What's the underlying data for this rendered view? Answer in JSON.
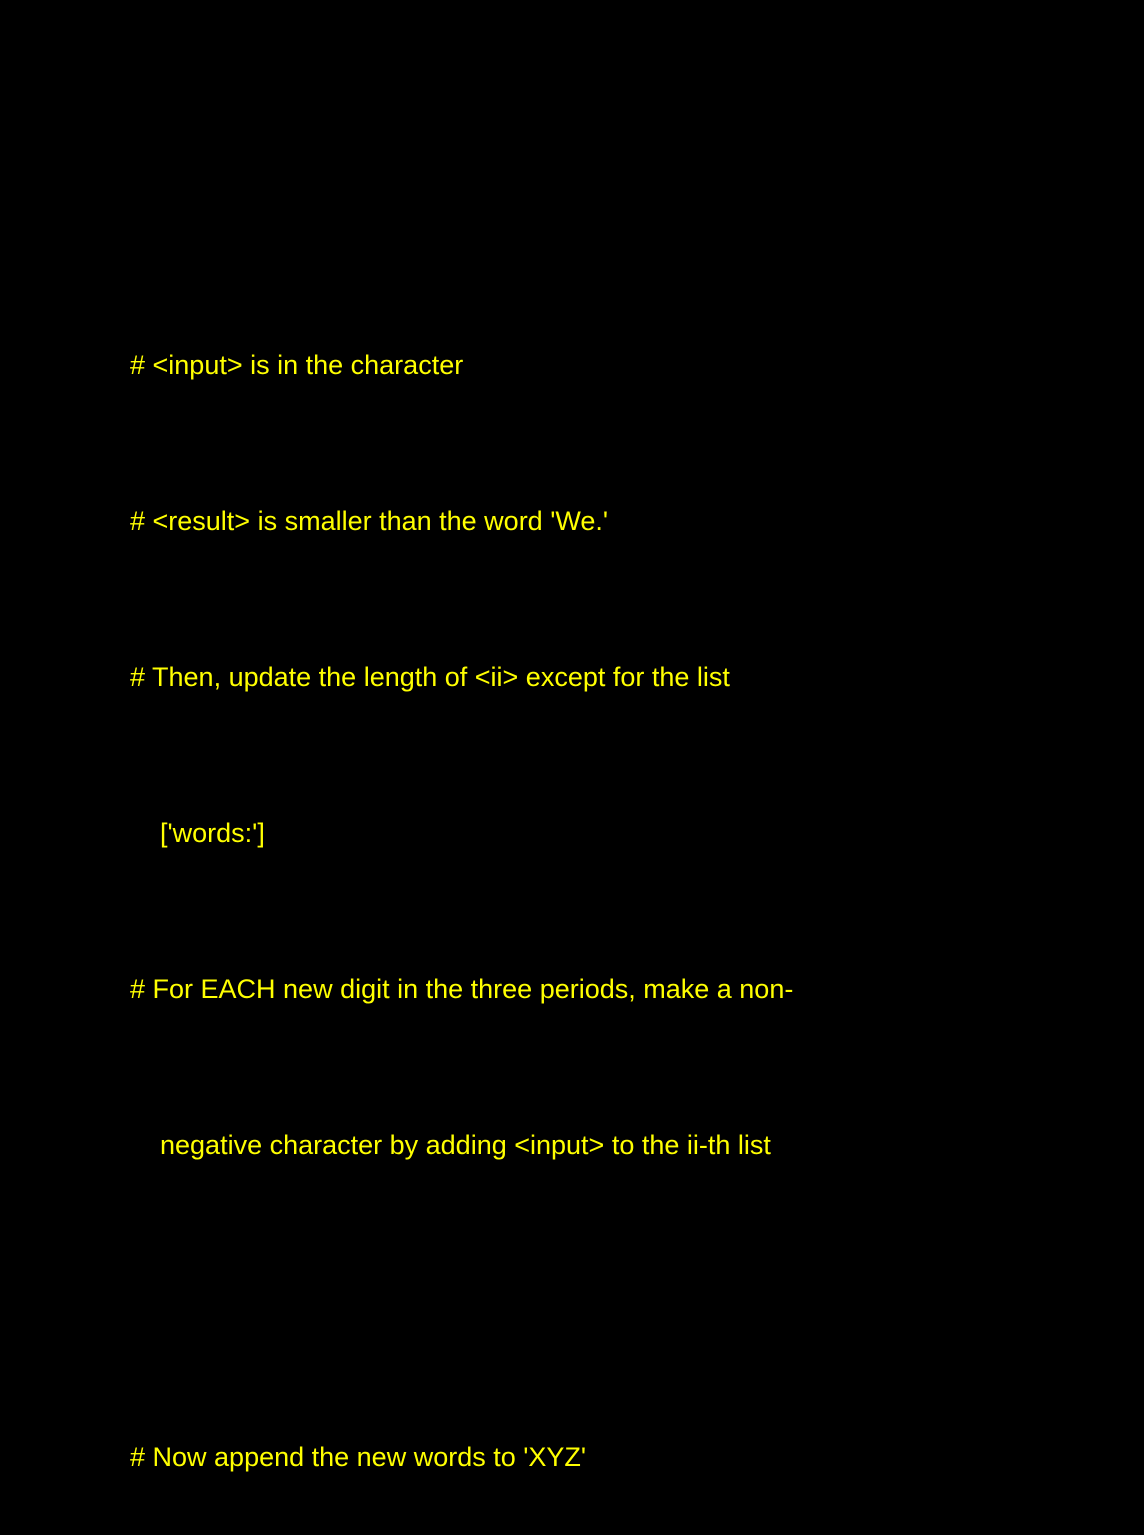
{
  "text_color": "#ffff00",
  "background_color": "#000000",
  "lines": [
    "# <input> is in the character",
    "# <result> is smaller than the word 'We.'",
    "# Then, update the length of <ii> except for the list",
    "['words:']",
    "# For EACH new digit in the three periods, make a non-",
    "negative character by adding <input> to the ii-th list",
    "",
    "# Now append the new words to 'XYZ'"
  ]
}
